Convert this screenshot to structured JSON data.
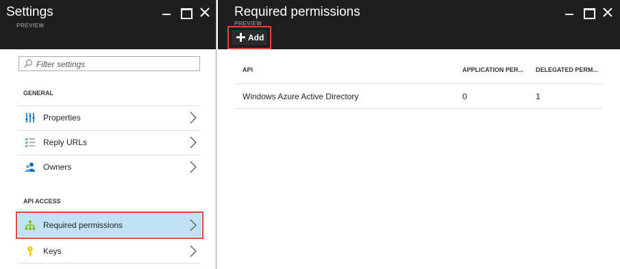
{
  "settings_blade": {
    "title": "Settings",
    "subtitle": "PREVIEW",
    "search": {
      "placeholder": "Filter settings",
      "value": ""
    },
    "sections": {
      "general": {
        "label": "GENERAL",
        "items": [
          {
            "label": "Properties",
            "icon": "properties-icon"
          },
          {
            "label": "Reply URLs",
            "icon": "checklist-icon"
          },
          {
            "label": "Owners",
            "icon": "owners-icon"
          }
        ]
      },
      "api_access": {
        "label": "API ACCESS",
        "items": [
          {
            "label": "Required permissions",
            "icon": "permissions-tree-icon",
            "selected": true
          },
          {
            "label": "Keys",
            "icon": "key-icon"
          }
        ]
      }
    }
  },
  "permissions_blade": {
    "title": "Required permissions",
    "subtitle": "PREVIEW",
    "toolbar": {
      "add_label": "Add"
    },
    "grid": {
      "columns": [
        "API",
        "APPLICATION PER...",
        "DELEGATED PERM..."
      ],
      "rows": [
        [
          "Windows Azure Active Directory",
          "0",
          "1"
        ]
      ]
    }
  },
  "colors": {
    "header_bg": "#1e1e1e",
    "selected_bg": "#bfe2f4",
    "highlight_border": "#e0453a",
    "accent_blue": "#0072c6"
  }
}
